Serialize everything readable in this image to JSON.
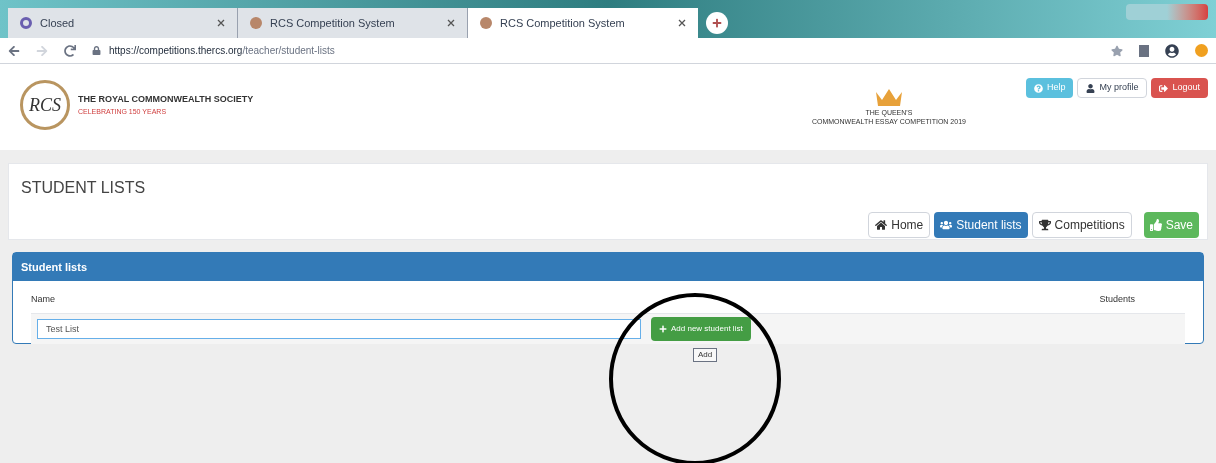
{
  "browser": {
    "tabs": [
      {
        "title": "Closed",
        "kind": "app",
        "selected": false
      },
      {
        "title": "RCS Competition System",
        "kind": "site",
        "selected": false
      },
      {
        "title": "RCS Competition System",
        "kind": "site",
        "selected": true
      }
    ],
    "url": {
      "host": "https://competitions.thercs.org",
      "path": "/teacher/student-lists"
    }
  },
  "header": {
    "org": "THE ROYAL COMMONWEALTH SOCIETY",
    "tagline": "CELEBRATING 150 YEARS",
    "logo": "RCS",
    "competition": [
      "THE QUEEN'S",
      "COMMONWEALTH ESSAY COMPETITION 2019"
    ],
    "buttons": [
      {
        "label": "Help",
        "kind": "info"
      },
      {
        "label": "My profile",
        "kind": "default"
      },
      {
        "label": "Logout",
        "kind": "danger"
      }
    ]
  },
  "page": {
    "title": "STUDENT LISTS",
    "nav": [
      {
        "label": "Home",
        "kind": "link",
        "selected": false
      },
      {
        "label": "Student lists",
        "kind": "link",
        "selected": true
      },
      {
        "label": "Competitions",
        "kind": "link",
        "selected": false
      },
      {
        "label": "Save",
        "kind": "action",
        "selected": false
      }
    ]
  },
  "panel": {
    "title": "Student lists",
    "columns": [
      "Name",
      "Students"
    ],
    "new_list": {
      "value": "Test List"
    },
    "add_button": "Add new student list",
    "tooltip": "Add"
  }
}
